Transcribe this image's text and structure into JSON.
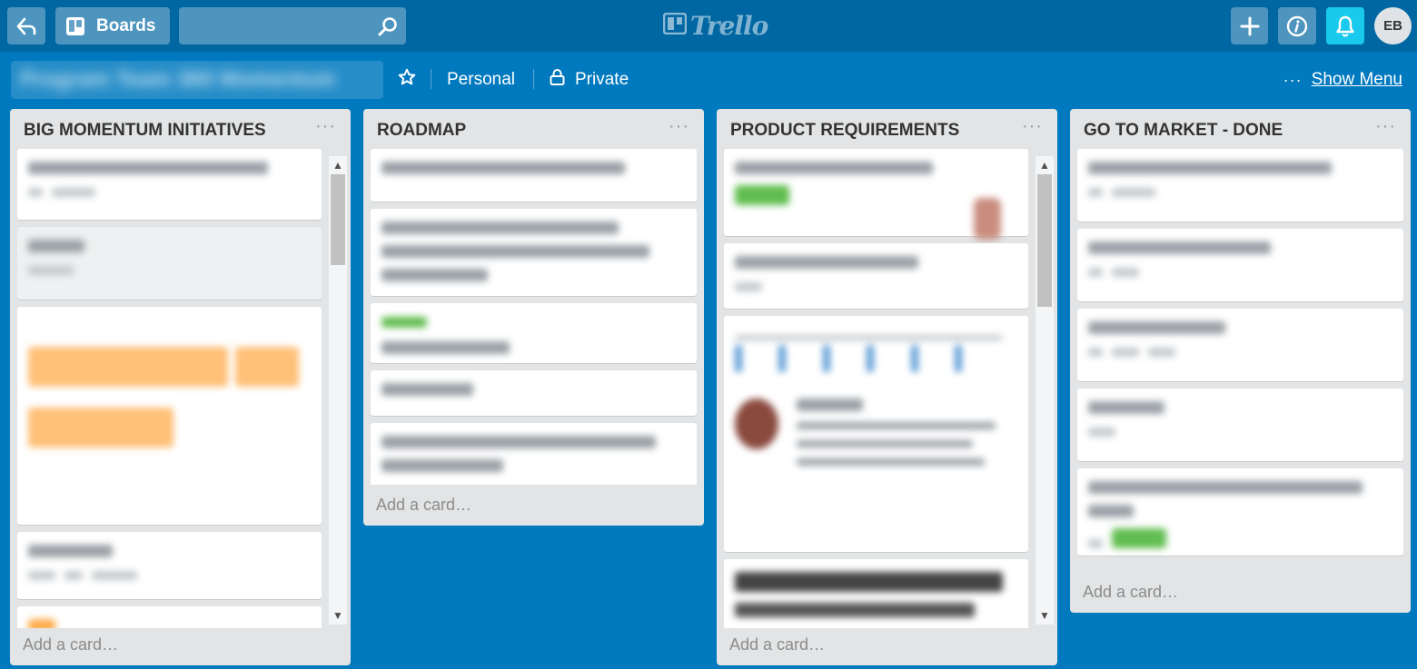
{
  "header": {
    "back_icon": "arrow-left-icon",
    "boards_label": "Boards",
    "search_placeholder": "",
    "logo_text": "Trello",
    "add_icon": "plus-icon",
    "info_icon": "info-icon",
    "notification_icon": "bell-icon",
    "avatar_initials": "EB"
  },
  "board": {
    "title": "Program Team 360 Momentum",
    "visibility_team": "Personal",
    "visibility_privacy": "Private",
    "menu_label": "Show Menu"
  },
  "lists": [
    {
      "title": "BIG MOMENTUM INITIATIVES",
      "add_card": "Add a card…"
    },
    {
      "title": "ROADMAP",
      "add_card": "Add a card…"
    },
    {
      "title": "PRODUCT REQUIREMENTS",
      "add_card": "Add a card…"
    },
    {
      "title": "GO TO MARKET - DONE",
      "add_card": "Add a card…"
    }
  ],
  "colors": {
    "board_bg": "#0079bf",
    "header_bg": "#0067a3",
    "notification_bg": "#1ac9ee",
    "list_bg": "#e2e4e6",
    "label_green": "#61bd4f"
  }
}
